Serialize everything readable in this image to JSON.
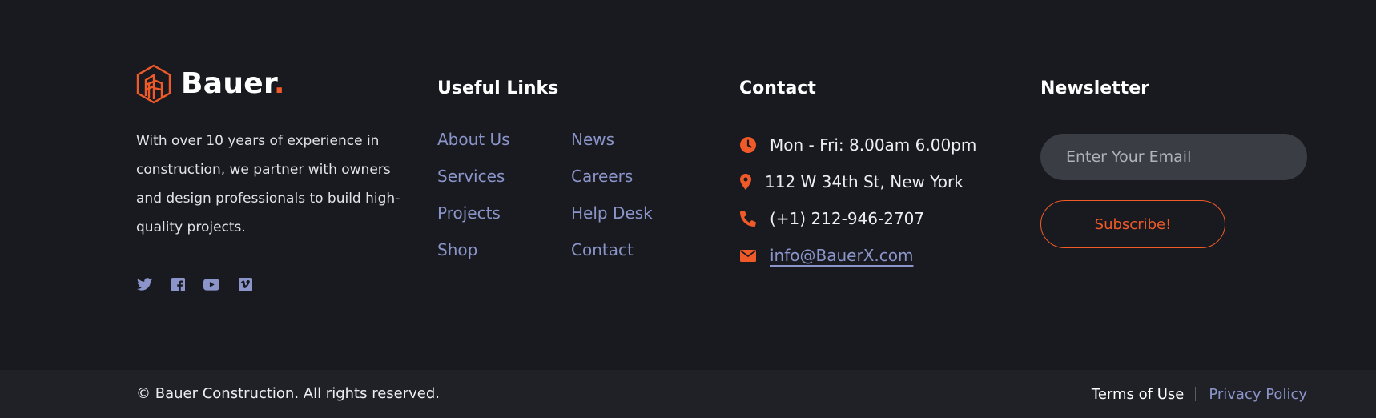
{
  "brand": {
    "name": "Bauer",
    "dot": ".",
    "about": "With over 10 years of experience in construction, we partner with owners and design professionals to build high-quality projects.",
    "socials": [
      "twitter-icon",
      "facebook-icon",
      "youtube-icon",
      "vimeo-icon"
    ],
    "accent_color": "#f05a28"
  },
  "useful_links": {
    "title": "Useful Links",
    "column_a": [
      "About Us",
      "Services",
      "Projects",
      "Shop"
    ],
    "column_b": [
      "News",
      "Careers",
      "Help Desk",
      "Contact"
    ]
  },
  "contact": {
    "title": "Contact",
    "hours": "Mon - Fri: 8.00am 6.00pm",
    "address": "112 W 34th St, New York",
    "phone": "(+1) 212-946-2707",
    "email": "info@BauerX.com",
    "icons": [
      "clock-icon",
      "map-pin-icon",
      "phone-icon",
      "envelope-icon"
    ]
  },
  "newsletter": {
    "title": "Newsletter",
    "placeholder": "Enter Your Email",
    "value": "",
    "button_label": "Subscribe!"
  },
  "bottom": {
    "copyright": "© Bauer Construction. All rights reserved.",
    "terms": "Terms of Use",
    "privacy": "Privacy Policy"
  },
  "colors": {
    "background": "#181a20",
    "bottom_bar": "#1f2127",
    "link": "#8b95c9",
    "accent": "#f05a28"
  }
}
